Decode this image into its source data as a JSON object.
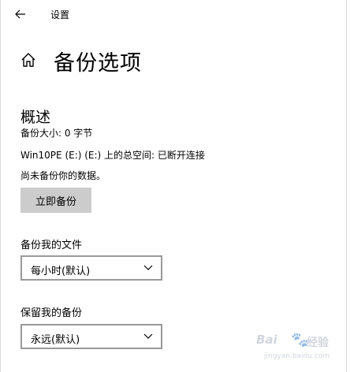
{
  "window": {
    "title": "设置"
  },
  "header": {
    "title": "备份选项"
  },
  "overview": {
    "heading": "概述",
    "size_line": "备份大小: 0 字节",
    "space_line": "Win10PE (E:) (E:) 上的总空间: 已断开连接",
    "status_line": "尚未备份你的数据。",
    "backup_now_label": "立即备份"
  },
  "backup_files": {
    "label": "备份我的文件",
    "selected": "每小时(默认)"
  },
  "keep_backups": {
    "label": "保留我的备份",
    "selected": "永远(默认)"
  },
  "watermark": {
    "logo": "Bai",
    "paw": "🐾",
    "text": "经验",
    "url": "jingyan.baidu.com"
  },
  "colors": {
    "button_bg": "#cccccc",
    "dropdown_border": "#999999",
    "text": "#000000"
  },
  "icons": {
    "back": "back-arrow-icon",
    "home": "home-icon",
    "dropdown": "chevron-down-icon"
  }
}
